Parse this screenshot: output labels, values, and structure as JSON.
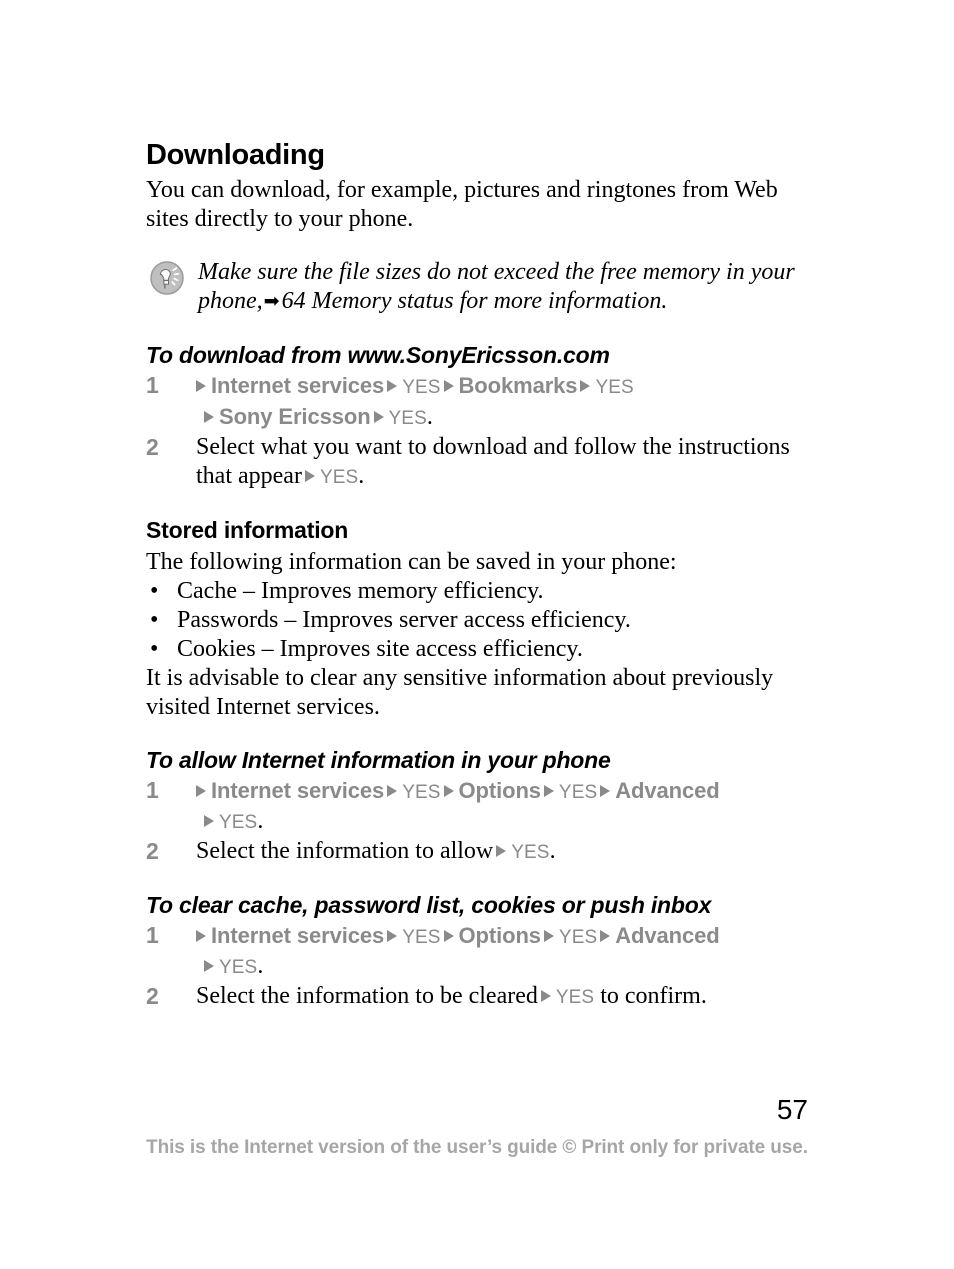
{
  "document": {
    "page_number": "57",
    "footer_note": "This is the Internet version of the user’s guide © Print only for private use."
  },
  "sections": {
    "downloading": {
      "heading": "Downloading",
      "intro": "You can download, for example, pictures and ringtones from Web sites directly to your phone.",
      "tip": {
        "icon": "lightbulb-tip-icon",
        "text_before": "Make sure the file sizes do not exceed the free memory in your phone,",
        "arrow": "➡",
        "text_after": "64 Memory status for more information."
      }
    },
    "download_from_site": {
      "heading": "To download from www.SonyEricsson.com",
      "steps": [
        {
          "num": "1",
          "line1": [
            {
              "type": "arrow"
            },
            {
              "type": "menu",
              "text": "Internet services"
            },
            {
              "type": "arrow"
            },
            {
              "type": "yes",
              "text": "YES"
            },
            {
              "type": "arrow"
            },
            {
              "type": "menu",
              "text": "Bookmarks"
            },
            {
              "type": "arrow"
            },
            {
              "type": "yes",
              "text": "YES"
            }
          ],
          "line2": [
            {
              "type": "arrow"
            },
            {
              "type": "menu",
              "text": "Sony Ericsson"
            },
            {
              "type": "arrow"
            },
            {
              "type": "yes",
              "text": "YES"
            },
            {
              "type": "period",
              "text": "."
            }
          ]
        },
        {
          "num": "2",
          "line1": [
            {
              "type": "body",
              "text": "Select what you want to download and follow the instructions that appear"
            },
            {
              "type": "arrow"
            },
            {
              "type": "yes",
              "text": "YES"
            },
            {
              "type": "period",
              "text": "."
            }
          ]
        }
      ]
    },
    "stored_information": {
      "heading": "Stored information",
      "intro": "The following information can be saved in your phone:",
      "bullets": [
        "Cache – Improves memory efficiency.",
        "Passwords – Improves server access efficiency.",
        "Cookies – Improves site access efficiency."
      ],
      "outro": "It is advisable to clear any sensitive information about previously visited Internet services."
    },
    "allow_internet_information": {
      "heading": "To allow Internet information in your phone",
      "steps": [
        {
          "num": "1",
          "line1": [
            {
              "type": "arrow"
            },
            {
              "type": "menu",
              "text": "Internet services"
            },
            {
              "type": "arrow"
            },
            {
              "type": "yes",
              "text": "YES"
            },
            {
              "type": "arrow"
            },
            {
              "type": "menu",
              "text": "Options"
            },
            {
              "type": "arrow"
            },
            {
              "type": "yes",
              "text": "YES"
            },
            {
              "type": "arrow"
            },
            {
              "type": "menu",
              "text": "Advanced"
            }
          ],
          "line2": [
            {
              "type": "arrow"
            },
            {
              "type": "yes",
              "text": "YES"
            },
            {
              "type": "period",
              "text": "."
            }
          ]
        },
        {
          "num": "2",
          "line1": [
            {
              "type": "body",
              "text": "Select the information to allow"
            },
            {
              "type": "arrow"
            },
            {
              "type": "yes",
              "text": "YES"
            },
            {
              "type": "period",
              "text": "."
            }
          ]
        }
      ]
    },
    "clear_cache": {
      "heading": "To clear cache, password list, cookies or push inbox",
      "steps": [
        {
          "num": "1",
          "line1": [
            {
              "type": "arrow"
            },
            {
              "type": "menu",
              "text": "Internet services"
            },
            {
              "type": "arrow"
            },
            {
              "type": "yes",
              "text": "YES"
            },
            {
              "type": "arrow"
            },
            {
              "type": "menu",
              "text": "Options"
            },
            {
              "type": "arrow"
            },
            {
              "type": "yes",
              "text": "YES"
            },
            {
              "type": "arrow"
            },
            {
              "type": "menu",
              "text": "Advanced"
            }
          ],
          "line2": [
            {
              "type": "arrow"
            },
            {
              "type": "yes",
              "text": "YES"
            },
            {
              "type": "period",
              "text": "."
            }
          ]
        },
        {
          "num": "2",
          "line1": [
            {
              "type": "body",
              "text": "Select the information to be cleared"
            },
            {
              "type": "arrow"
            },
            {
              "type": "yes",
              "text": "YES"
            },
            {
              "type": "body",
              "text": " to confirm."
            }
          ]
        }
      ]
    }
  },
  "colors": {
    "menu_grey": "#8a8a8a",
    "footer_grey": "#a6a6a6",
    "text_black": "#000000"
  }
}
